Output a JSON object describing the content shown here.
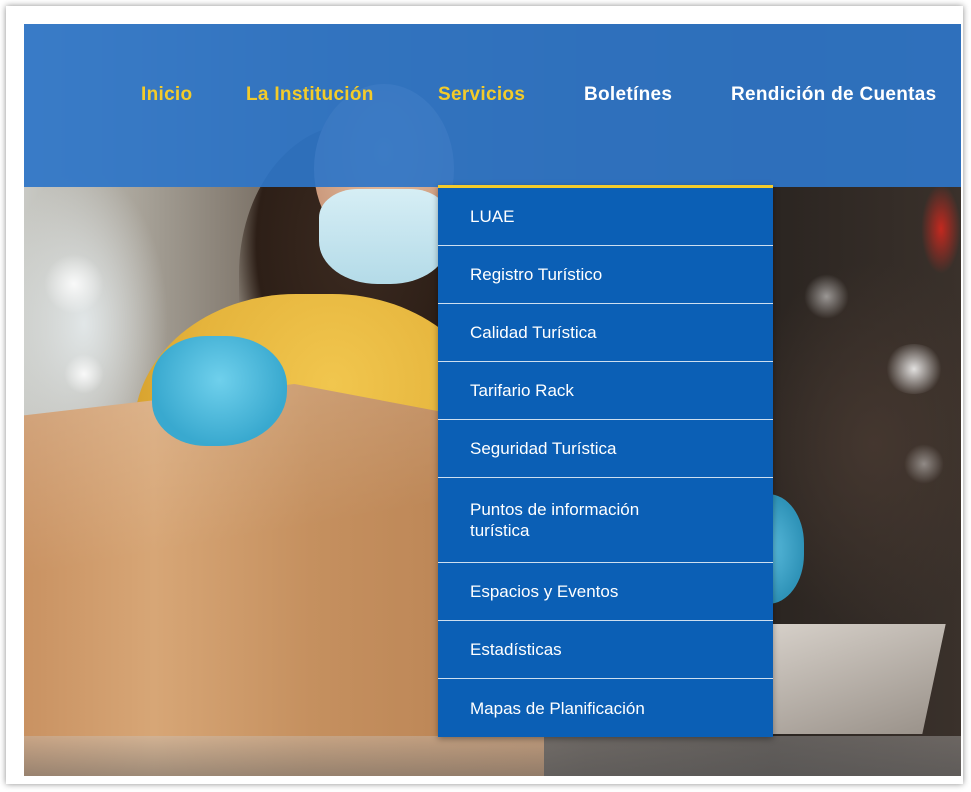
{
  "nav": {
    "items": [
      {
        "label": "Inicio",
        "color": "#f3cb2a"
      },
      {
        "label": "La Institución",
        "color": "#f3cb2a"
      },
      {
        "label": "Servicios",
        "color": "#f3cb2a"
      },
      {
        "label": "Boletínes",
        "color": "#ffffff"
      },
      {
        "label": "Rendición de Cuentas",
        "color": "#ffffff"
      }
    ]
  },
  "dropdown": {
    "parent": "Servicios",
    "items": [
      {
        "label": "LUAE"
      },
      {
        "label": "Registro Turístico"
      },
      {
        "label": "Calidad Turística"
      },
      {
        "label": "Tarifario Rack"
      },
      {
        "label": "Seguridad Turística"
      },
      {
        "label": "Puntos de información turística"
      },
      {
        "label": "Espacios y Eventos"
      },
      {
        "label": "Estadísticas"
      },
      {
        "label": "Mapas de Planificación"
      }
    ]
  },
  "colors": {
    "header_blue": "#2e75c7",
    "dropdown_blue": "#0b5fb5",
    "accent_yellow": "#f3cb2a"
  }
}
